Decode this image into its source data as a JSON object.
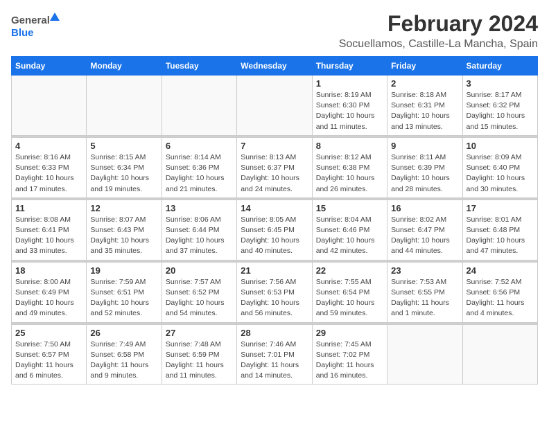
{
  "header": {
    "logo_general": "General",
    "logo_blue": "Blue",
    "month": "February 2024",
    "location": "Socuellamos, Castille-La Mancha, Spain"
  },
  "weekdays": [
    "Sunday",
    "Monday",
    "Tuesday",
    "Wednesday",
    "Thursday",
    "Friday",
    "Saturday"
  ],
  "weeks": [
    [
      {
        "day": "",
        "info": ""
      },
      {
        "day": "",
        "info": ""
      },
      {
        "day": "",
        "info": ""
      },
      {
        "day": "",
        "info": ""
      },
      {
        "day": "1",
        "info": "Sunrise: 8:19 AM\nSunset: 6:30 PM\nDaylight: 10 hours\nand 11 minutes."
      },
      {
        "day": "2",
        "info": "Sunrise: 8:18 AM\nSunset: 6:31 PM\nDaylight: 10 hours\nand 13 minutes."
      },
      {
        "day": "3",
        "info": "Sunrise: 8:17 AM\nSunset: 6:32 PM\nDaylight: 10 hours\nand 15 minutes."
      }
    ],
    [
      {
        "day": "4",
        "info": "Sunrise: 8:16 AM\nSunset: 6:33 PM\nDaylight: 10 hours\nand 17 minutes."
      },
      {
        "day": "5",
        "info": "Sunrise: 8:15 AM\nSunset: 6:34 PM\nDaylight: 10 hours\nand 19 minutes."
      },
      {
        "day": "6",
        "info": "Sunrise: 8:14 AM\nSunset: 6:36 PM\nDaylight: 10 hours\nand 21 minutes."
      },
      {
        "day": "7",
        "info": "Sunrise: 8:13 AM\nSunset: 6:37 PM\nDaylight: 10 hours\nand 24 minutes."
      },
      {
        "day": "8",
        "info": "Sunrise: 8:12 AM\nSunset: 6:38 PM\nDaylight: 10 hours\nand 26 minutes."
      },
      {
        "day": "9",
        "info": "Sunrise: 8:11 AM\nSunset: 6:39 PM\nDaylight: 10 hours\nand 28 minutes."
      },
      {
        "day": "10",
        "info": "Sunrise: 8:09 AM\nSunset: 6:40 PM\nDaylight: 10 hours\nand 30 minutes."
      }
    ],
    [
      {
        "day": "11",
        "info": "Sunrise: 8:08 AM\nSunset: 6:41 PM\nDaylight: 10 hours\nand 33 minutes."
      },
      {
        "day": "12",
        "info": "Sunrise: 8:07 AM\nSunset: 6:43 PM\nDaylight: 10 hours\nand 35 minutes."
      },
      {
        "day": "13",
        "info": "Sunrise: 8:06 AM\nSunset: 6:44 PM\nDaylight: 10 hours\nand 37 minutes."
      },
      {
        "day": "14",
        "info": "Sunrise: 8:05 AM\nSunset: 6:45 PM\nDaylight: 10 hours\nand 40 minutes."
      },
      {
        "day": "15",
        "info": "Sunrise: 8:04 AM\nSunset: 6:46 PM\nDaylight: 10 hours\nand 42 minutes."
      },
      {
        "day": "16",
        "info": "Sunrise: 8:02 AM\nSunset: 6:47 PM\nDaylight: 10 hours\nand 44 minutes."
      },
      {
        "day": "17",
        "info": "Sunrise: 8:01 AM\nSunset: 6:48 PM\nDaylight: 10 hours\nand 47 minutes."
      }
    ],
    [
      {
        "day": "18",
        "info": "Sunrise: 8:00 AM\nSunset: 6:49 PM\nDaylight: 10 hours\nand 49 minutes."
      },
      {
        "day": "19",
        "info": "Sunrise: 7:59 AM\nSunset: 6:51 PM\nDaylight: 10 hours\nand 52 minutes."
      },
      {
        "day": "20",
        "info": "Sunrise: 7:57 AM\nSunset: 6:52 PM\nDaylight: 10 hours\nand 54 minutes."
      },
      {
        "day": "21",
        "info": "Sunrise: 7:56 AM\nSunset: 6:53 PM\nDaylight: 10 hours\nand 56 minutes."
      },
      {
        "day": "22",
        "info": "Sunrise: 7:55 AM\nSunset: 6:54 PM\nDaylight: 10 hours\nand 59 minutes."
      },
      {
        "day": "23",
        "info": "Sunrise: 7:53 AM\nSunset: 6:55 PM\nDaylight: 11 hours\nand 1 minute."
      },
      {
        "day": "24",
        "info": "Sunrise: 7:52 AM\nSunset: 6:56 PM\nDaylight: 11 hours\nand 4 minutes."
      }
    ],
    [
      {
        "day": "25",
        "info": "Sunrise: 7:50 AM\nSunset: 6:57 PM\nDaylight: 11 hours\nand 6 minutes."
      },
      {
        "day": "26",
        "info": "Sunrise: 7:49 AM\nSunset: 6:58 PM\nDaylight: 11 hours\nand 9 minutes."
      },
      {
        "day": "27",
        "info": "Sunrise: 7:48 AM\nSunset: 6:59 PM\nDaylight: 11 hours\nand 11 minutes."
      },
      {
        "day": "28",
        "info": "Sunrise: 7:46 AM\nSunset: 7:01 PM\nDaylight: 11 hours\nand 14 minutes."
      },
      {
        "day": "29",
        "info": "Sunrise: 7:45 AM\nSunset: 7:02 PM\nDaylight: 11 hours\nand 16 minutes."
      },
      {
        "day": "",
        "info": ""
      },
      {
        "day": "",
        "info": ""
      }
    ]
  ]
}
